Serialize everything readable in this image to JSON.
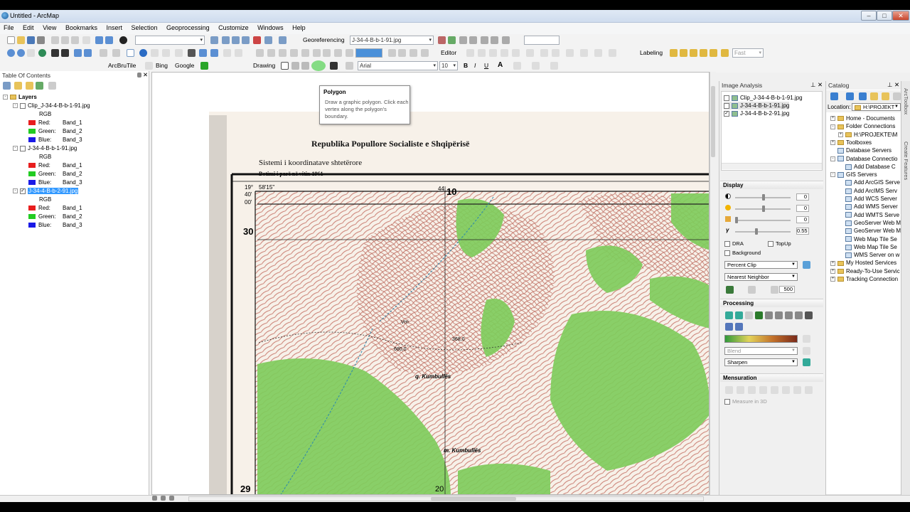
{
  "window": {
    "title": "Untitled - ArcMap"
  },
  "menu": [
    "File",
    "Edit",
    "View",
    "Bookmarks",
    "Insert",
    "Selection",
    "Geoprocessing",
    "Customize",
    "Windows",
    "Help"
  ],
  "toolbars": {
    "georef_label": "Georeferencing",
    "georef_layer": "J-34-4-B-b-1-91.jpg",
    "editor_label": "Editor",
    "labeling_label": "Labeling",
    "fast_value": "Fast",
    "arcbrutile_label": "ArcBruTile",
    "bing_label": "Bing",
    "google_label": "Google",
    "drawing_label": "Drawing",
    "font_name": "Arial",
    "font_size": "10",
    "bold": "B",
    "italic": "I",
    "underline": "U",
    "text_a": "A"
  },
  "tooltip": {
    "title": "Polygon",
    "desc": "Draw a graphic polygon. Click each vertex along the polygon's boundary."
  },
  "toc": {
    "title": "Table Of Contents",
    "root": "Layers",
    "layers": [
      {
        "name": "Clip_J-34-4-B-b-1-91.jpg",
        "checked": false,
        "selected": false
      },
      {
        "name": "J-34-4-B-b-1-91.jpg",
        "checked": false,
        "selected": false
      },
      {
        "name": "J-34-4-B-b-2-91.jpg",
        "checked": true,
        "selected": true
      }
    ],
    "rgb_label": "RGB",
    "bands": [
      {
        "label": "Red:",
        "value": "Band_1",
        "color": "#e81e1e"
      },
      {
        "label": "Green:",
        "value": "Band_2",
        "color": "#22cc22"
      },
      {
        "label": "Blue:",
        "value": "Band_3",
        "color": "#1a1ae6"
      }
    ]
  },
  "map": {
    "title": "Republika Popullore Socialiste e Shqipërisë",
    "subtitle": "Sistemi i koordinatave shtetërore",
    "subtitle2": "Botimi i parë në vitin 1961",
    "lat_deg": "19°",
    "lat_min": "40'",
    "lon": "58'15\"",
    "tick_44": "44",
    "grid_10": "10",
    "grid_30": "30",
    "grid_29": "29",
    "grid_20": "20",
    "min_00": "00'",
    "place1": "q. Kumbullës",
    "place2": "m. Kumbullës",
    "spot1": "680,0",
    "spot2": "368,0",
    "spot3": "Vrri"
  },
  "image_analysis": {
    "title": "Image Analysis",
    "layers": [
      {
        "name": "Clip_J-34-4-B-b-1-91.jpg",
        "checked": false
      },
      {
        "name": "J-34-4-B-b-1-91.jpg",
        "checked": false
      },
      {
        "name": "J-34-4-B-b-2-91.jpg",
        "checked": true
      }
    ],
    "display_title": "Display",
    "contrast": "0",
    "brightness": "0",
    "transparency": "0",
    "gamma": "0.55",
    "dra": "DRA",
    "topup": "TopUp",
    "background": "Background",
    "stretch": "Percent Clip",
    "resample": "Nearest Neighbor",
    "zoom_value": "500",
    "processing_title": "Processing",
    "blend": "Blend",
    "sharpen": "Sharpen",
    "mensuration_title": "Mensuration",
    "measure3d": "Measure in 3D"
  },
  "catalog": {
    "title": "Catalog",
    "location_label": "Location:",
    "location_value": "H:\\PROJEKT",
    "items": [
      {
        "label": "Home - Documents",
        "kind": "folder",
        "indent": 0,
        "exp": "+"
      },
      {
        "label": "Folder Connections",
        "kind": "folder",
        "indent": 0,
        "exp": "-"
      },
      {
        "label": "H:\\PROJEKTE\\M",
        "kind": "folder",
        "indent": 1,
        "exp": "+"
      },
      {
        "label": "Toolboxes",
        "kind": "folder",
        "indent": 0,
        "exp": "+"
      },
      {
        "label": "Database Servers",
        "kind": "srv",
        "indent": 0,
        "exp": ""
      },
      {
        "label": "Database Connectio",
        "kind": "srv",
        "indent": 0,
        "exp": "-"
      },
      {
        "label": "Add Database C",
        "kind": "srv",
        "indent": 1,
        "exp": ""
      },
      {
        "label": "GIS Servers",
        "kind": "srv",
        "indent": 0,
        "exp": "-"
      },
      {
        "label": "Add ArcGIS Serve",
        "kind": "srv",
        "indent": 1,
        "exp": ""
      },
      {
        "label": "Add ArcIMS Serv",
        "kind": "srv",
        "indent": 1,
        "exp": ""
      },
      {
        "label": "Add WCS Server",
        "kind": "srv",
        "indent": 1,
        "exp": ""
      },
      {
        "label": "Add WMS Server",
        "kind": "srv",
        "indent": 1,
        "exp": ""
      },
      {
        "label": "Add WMTS Serve",
        "kind": "srv",
        "indent": 1,
        "exp": ""
      },
      {
        "label": "GeoServer Web M",
        "kind": "srv",
        "indent": 1,
        "exp": ""
      },
      {
        "label": "GeoServer Web M",
        "kind": "srv",
        "indent": 1,
        "exp": ""
      },
      {
        "label": "Web Map Tile Se",
        "kind": "srv",
        "indent": 1,
        "exp": ""
      },
      {
        "label": "Web Map Tile Se",
        "kind": "srv",
        "indent": 1,
        "exp": ""
      },
      {
        "label": "WMS Server on w",
        "kind": "srv",
        "indent": 1,
        "exp": ""
      },
      {
        "label": "My Hosted Services",
        "kind": "folder",
        "indent": 0,
        "exp": "+"
      },
      {
        "label": "Ready-To-Use Servic",
        "kind": "folder",
        "indent": 0,
        "exp": "+"
      },
      {
        "label": "Tracking Connection",
        "kind": "folder",
        "indent": 0,
        "exp": "+"
      }
    ],
    "side_tabs": [
      "ArcToolbox",
      "Create Features"
    ]
  }
}
